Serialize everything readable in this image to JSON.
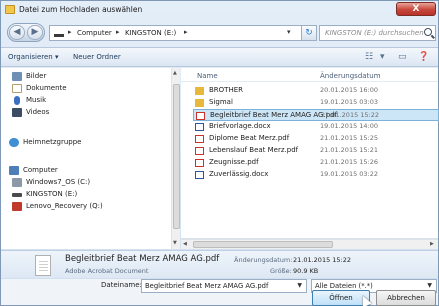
{
  "window": {
    "title": "Datei zum Hochladen auswählen",
    "close_label": "X"
  },
  "address": {
    "crumbs": [
      "Computer",
      "KINGSTON (E:)"
    ],
    "separator": "▸",
    "search_placeholder": "KINGSTON (E:) durchsuchen"
  },
  "toolbar": {
    "organize": "Organisieren ▾",
    "new_folder": "Neuer Ordner"
  },
  "nav": {
    "items": [
      {
        "label": "Bilder",
        "icon": "pictures-library-icon",
        "color": "#6f8fb5"
      },
      {
        "label": "Dokumente",
        "icon": "documents-library-icon",
        "color": "#d9c88a"
      },
      {
        "label": "Musik",
        "icon": "music-library-icon",
        "color": "#3a6fc4"
      },
      {
        "label": "Videos",
        "icon": "videos-library-icon",
        "color": "#5b7393"
      },
      {
        "label": "Heimnetzgruppe",
        "icon": "homegroup-icon",
        "color": "#3f8fd4"
      },
      {
        "label": "Computer",
        "icon": "computer-icon",
        "color": "#4f7fb8"
      },
      {
        "label": "Windows7_OS (C:)",
        "icon": "drive-c-icon",
        "color": "#7c8a99"
      },
      {
        "label": "KINGSTON (E:)",
        "icon": "usb-drive-icon",
        "color": "#5d5d5d"
      },
      {
        "label": "Lenovo_Recovery (Q:)",
        "icon": "recovery-drive-icon",
        "color": "#c0392b"
      }
    ]
  },
  "list": {
    "columns": {
      "name": "Name",
      "date": "Änderungsdatum"
    },
    "files": [
      {
        "name": "BROTHER",
        "date": "20.01.2015 16:00",
        "type": "folder"
      },
      {
        "name": "Sigmal",
        "date": "19.01.2015 03:03",
        "type": "folder"
      },
      {
        "name": "Begleitbrief Beat Merz AMAG AG.pdf",
        "date": "21.01.2015 15:22",
        "type": "pdf",
        "selected": true
      },
      {
        "name": "Briefvorlage.docx",
        "date": "19.01.2015 14:00",
        "type": "docx"
      },
      {
        "name": "Diplome Beat Merz.pdf",
        "date": "21.01.2015 15:25",
        "type": "pdf"
      },
      {
        "name": "Lebenslauf Beat Merz.pdf",
        "date": "21.01.2015 15:21",
        "type": "pdf"
      },
      {
        "name": "Zeugnisse.pdf",
        "date": "21.01.2015 15:26",
        "type": "pdf"
      },
      {
        "name": "Zuverlässig.docx",
        "date": "19.01.2015 03:22",
        "type": "docx"
      }
    ]
  },
  "details": {
    "name": "Begleitbrief Beat Merz AMAG AG.pdf",
    "type": "Adobe Acrobat Document",
    "modified_label": "Änderungsdatum:",
    "modified_value": "21.01.2015 15:22",
    "size_label": "Größe:",
    "size_value": "90.9 KB"
  },
  "bottom": {
    "filename_label": "Dateiname:",
    "filename_value": "Begleitbrief Beat Merz AMAG AG.pdf",
    "filetype_value": "Alle Dateien (*.*)",
    "open_label": "Öffnen",
    "cancel_label": "Abbrechen"
  },
  "colors": {
    "pdf": "#c8332b",
    "folder": "#e8b83a",
    "docx": "#2b5797",
    "selected": "#cde6f7"
  }
}
